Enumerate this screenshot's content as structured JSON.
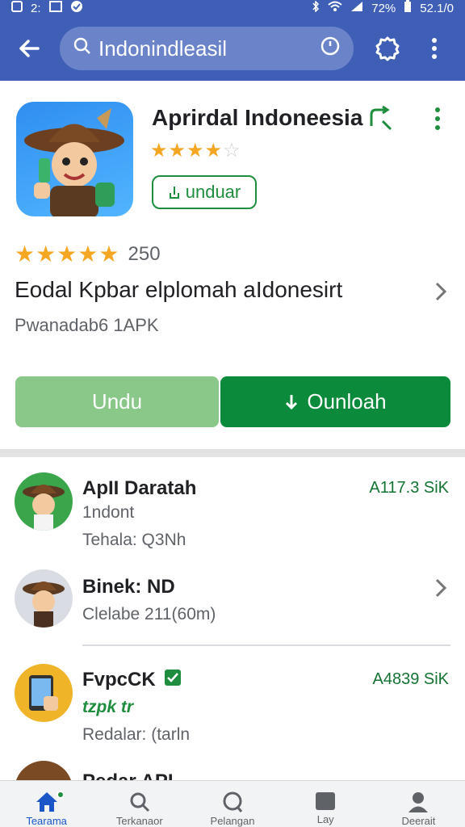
{
  "status_bar": {
    "left_text": "2:",
    "battery": "72%",
    "time": "52.1/0"
  },
  "search": {
    "value": "Indonindleasil"
  },
  "app": {
    "title": "Aprirdal Indoneesia",
    "install_label": "unduar",
    "rating_count": "250",
    "description": "Eodal Kpbar elplomah aIdonesirt",
    "subtitle": "Pwanadab6 1APK"
  },
  "actions": {
    "secondary_label": "Undu",
    "primary_label": "Ounloah"
  },
  "list": [
    {
      "title": "ApII Daratah",
      "line1": "1ndont",
      "line2": "Tehala: Q3Nh",
      "meta": "A117.3 SiK"
    },
    {
      "title": "Binek: ND",
      "line1": "Clelabe 211(60m)"
    },
    {
      "title": "FvpcCK",
      "line1": "tzpk tr",
      "line2": "Redalar: (tarln",
      "meta": "A4839 SiK"
    },
    {
      "title": "Pedar API"
    }
  ],
  "nav": [
    {
      "label": "Tearama",
      "icon": "home-icon"
    },
    {
      "label": "Terkanaor",
      "icon": "search-icon"
    },
    {
      "label": "Pelangan",
      "icon": "search-icon"
    },
    {
      "label": "Lay",
      "icon": "folder-icon"
    },
    {
      "label": "Deerait",
      "icon": "person-icon"
    }
  ],
  "colors": {
    "appbar": "#3f5fb6",
    "accent_green": "#0a8a3a",
    "light_green": "#8ac88a",
    "star": "#f5a623",
    "nav_active": "#1a56c8"
  }
}
